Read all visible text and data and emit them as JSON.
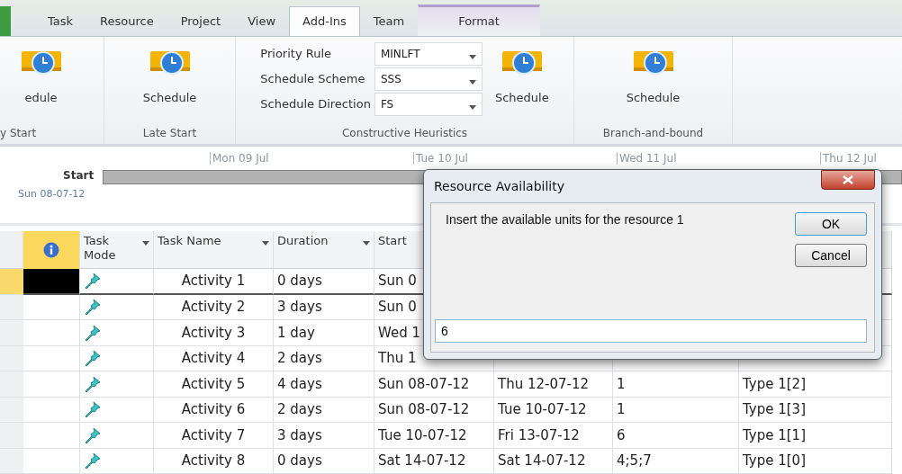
{
  "ribbon_tabs": [
    {
      "kind": "file",
      "selected": false
    },
    {
      "label": "Task",
      "kind": "normal",
      "selected": false
    },
    {
      "label": "Resource",
      "kind": "normal",
      "selected": false
    },
    {
      "label": "Project",
      "kind": "normal",
      "selected": false
    },
    {
      "label": "View",
      "kind": "normal",
      "selected": false
    },
    {
      "label": "Add-Ins",
      "kind": "normal",
      "selected": true
    },
    {
      "label": "Team",
      "kind": "normal",
      "selected": false
    },
    {
      "label": "Format",
      "kind": "contextual",
      "selected": false
    }
  ],
  "ribbon_groups": [
    {
      "kind": "buttons",
      "label": "y Start",
      "buttons": [
        "edule"
      ]
    },
    {
      "kind": "buttons",
      "label": "Late Start",
      "buttons": [
        "Schedule"
      ]
    },
    {
      "kind": "heuristics",
      "label": "Constructive Heuristics",
      "fields": [
        {
          "label": "Priority Rule",
          "value": "MINLFT"
        },
        {
          "label": "Schedule Scheme",
          "value": "SSS"
        },
        {
          "label": "Schedule Direction",
          "value": "FS"
        }
      ],
      "buttons": [
        "Schedule"
      ]
    },
    {
      "kind": "buttons",
      "label": "Branch-and-bound",
      "buttons": [
        "Schedule"
      ]
    }
  ],
  "timeline": {
    "dates": [
      "Mon 09 Jul",
      "Tue 10 Jul",
      "Wed 11 Jul",
      "Thu 12 Jul"
    ],
    "start_label": "Start",
    "start_date": "Sun 08-07-12"
  },
  "table": {
    "columns": [
      "Task Mode",
      "Task Name",
      "Duration",
      "Start"
    ],
    "rows": [
      {
        "selected": true,
        "name": "Activity 1",
        "duration": "0 days",
        "start": "Sun 0"
      },
      {
        "selected": false,
        "name": "Activity 2",
        "duration": "3 days",
        "start": "Sun 0"
      },
      {
        "selected": false,
        "name": "Activity 3",
        "duration": "1 day",
        "start": "Wed 1"
      },
      {
        "selected": false,
        "name": "Activity 4",
        "duration": "2 days",
        "start": "Thu 1"
      },
      {
        "selected": false,
        "name": "Activity 5",
        "duration": "4 days",
        "start": "Sun 08-07-12",
        "finish": "Thu 12-07-12",
        "predecessors": "1",
        "resource": "Type 1[2]"
      },
      {
        "selected": false,
        "name": "Activity 6",
        "duration": "2 days",
        "start": "Sun 08-07-12",
        "finish": "Tue 10-07-12",
        "predecessors": "1",
        "resource": "Type 1[3]"
      },
      {
        "selected": false,
        "name": "Activity 7",
        "duration": "3 days",
        "start": "Tue 10-07-12",
        "finish": "Fri 13-07-12",
        "predecessors": "6",
        "resource": "Type 1[1]"
      },
      {
        "selected": false,
        "name": "Activity 8",
        "duration": "0 days",
        "start": "Sat 14-07-12",
        "finish": "Sat 14-07-12",
        "predecessors": "4;5;7",
        "resource": "Type 1[0]"
      }
    ]
  },
  "dialog": {
    "title": "Resource Availability",
    "message": "Insert the available units for the resource 1",
    "buttons": [
      "OK",
      "Cancel"
    ],
    "value": "6"
  }
}
